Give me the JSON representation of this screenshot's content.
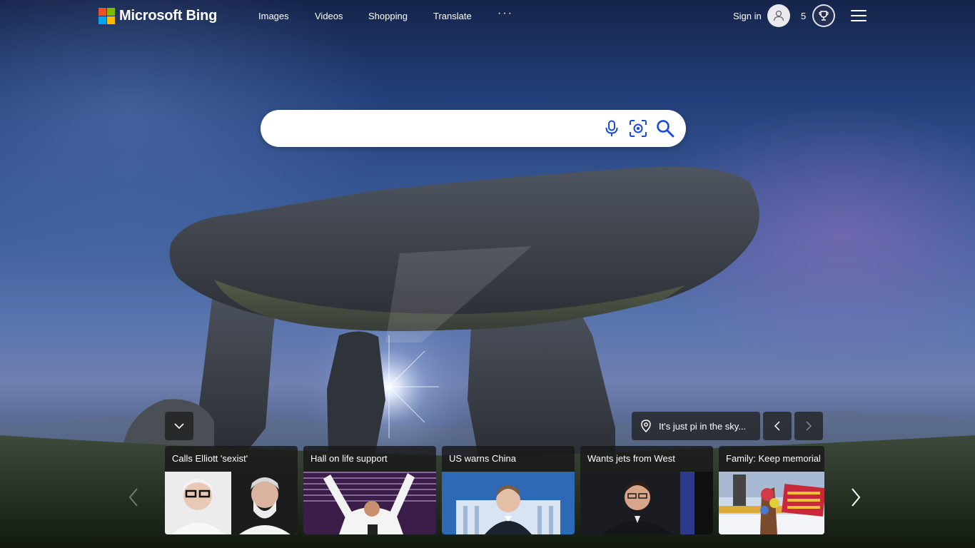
{
  "brand": {
    "logo_text": "Microsoft Bing"
  },
  "nav": {
    "items": [
      {
        "label": "Images"
      },
      {
        "label": "Videos"
      },
      {
        "label": "Shopping"
      },
      {
        "label": "Translate"
      }
    ],
    "more_label": "···"
  },
  "account": {
    "signin_label": "Sign in"
  },
  "rewards": {
    "points": "5"
  },
  "search": {
    "value": "",
    "placeholder": ""
  },
  "image_info": {
    "caption": "It's just pi in the sky..."
  },
  "news": [
    {
      "headline": "Calls Elliott 'sexist'"
    },
    {
      "headline": "Hall on life support"
    },
    {
      "headline": "US warns China"
    },
    {
      "headline": "Wants jets from West"
    },
    {
      "headline": "Family: Keep memorial"
    }
  ],
  "colors": {
    "accent": "#174ae4",
    "ms_red": "#f25022",
    "ms_green": "#7fba00",
    "ms_blue": "#00a4ef",
    "ms_yellow": "#ffb900"
  }
}
